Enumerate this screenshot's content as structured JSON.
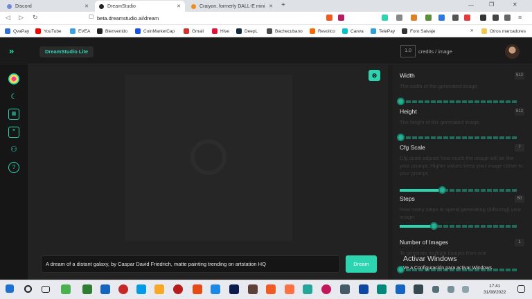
{
  "browser": {
    "tabs": [
      {
        "title": "Discord",
        "color": "#7289da"
      },
      {
        "title": "DreamStudio",
        "color": "#222222"
      },
      {
        "title": "Craiyon, formerly DALL-E mini",
        "color": "#f08a24"
      }
    ],
    "new_tab": "+",
    "url": "beta.dreamstudio.ai/dream",
    "bookmarks": [
      {
        "label": "QvaPay",
        "color": "#2f6fe0"
      },
      {
        "label": "YouTube",
        "color": "#ff0000"
      },
      {
        "label": "EVEA",
        "color": "#3aa0e8"
      },
      {
        "label": "Bienvenido",
        "color": "#222222"
      },
      {
        "label": "CoinMarketCap",
        "color": "#1652f0"
      },
      {
        "label": "Gmail",
        "color": "#d93025"
      },
      {
        "label": "Hive",
        "color": "#e31337"
      },
      {
        "label": "DeepL",
        "color": "#0f2b46"
      },
      {
        "label": "Bachecubano",
        "color": "#4a4a4a"
      },
      {
        "label": "Revolico",
        "color": "#ff6600"
      },
      {
        "label": "Canva",
        "color": "#00c4cc"
      },
      {
        "label": "TelePay",
        "color": "#2aa1e0"
      },
      {
        "label": "Foro Salvaje",
        "color": "#333333"
      },
      {
        "label": "Otros marcadores",
        "color": "#f2c94c"
      }
    ]
  },
  "app": {
    "brand": "DreamStudio Lite",
    "credits_value": "1.0",
    "credits_label": "credits / image",
    "accent": "#2dd4b0",
    "prompt": "A dream of a distant galaxy, by Caspar David Friedrich, matte painting trending on artstation HQ",
    "dream_button": "Dream",
    "controls": [
      {
        "label": "Width",
        "value": "512",
        "description": "The width of the generated image.",
        "level": 0.0
      },
      {
        "label": "Height",
        "value": "512",
        "description": "The height of the generated image.",
        "level": 0.0
      },
      {
        "label": "Cfg Scale",
        "value": "7",
        "description": "Cfg scale adjusts how much the image will be like your prompt. Higher values keep your image closer to your prompt.",
        "level": 0.35
      },
      {
        "label": "Steps",
        "value": "50",
        "description": "How many steps to spend generating (diffusing) your image.",
        "level": 0.28
      },
      {
        "label": "Number of Images",
        "value": "1",
        "description": "To generate multiple images from one",
        "level": 0.0
      }
    ]
  },
  "windows": {
    "activate_title": "Activar Windows",
    "activate_sub": "Ve a Configuración para activar Windows.",
    "time": "17:41",
    "date": "31/08/2022"
  }
}
